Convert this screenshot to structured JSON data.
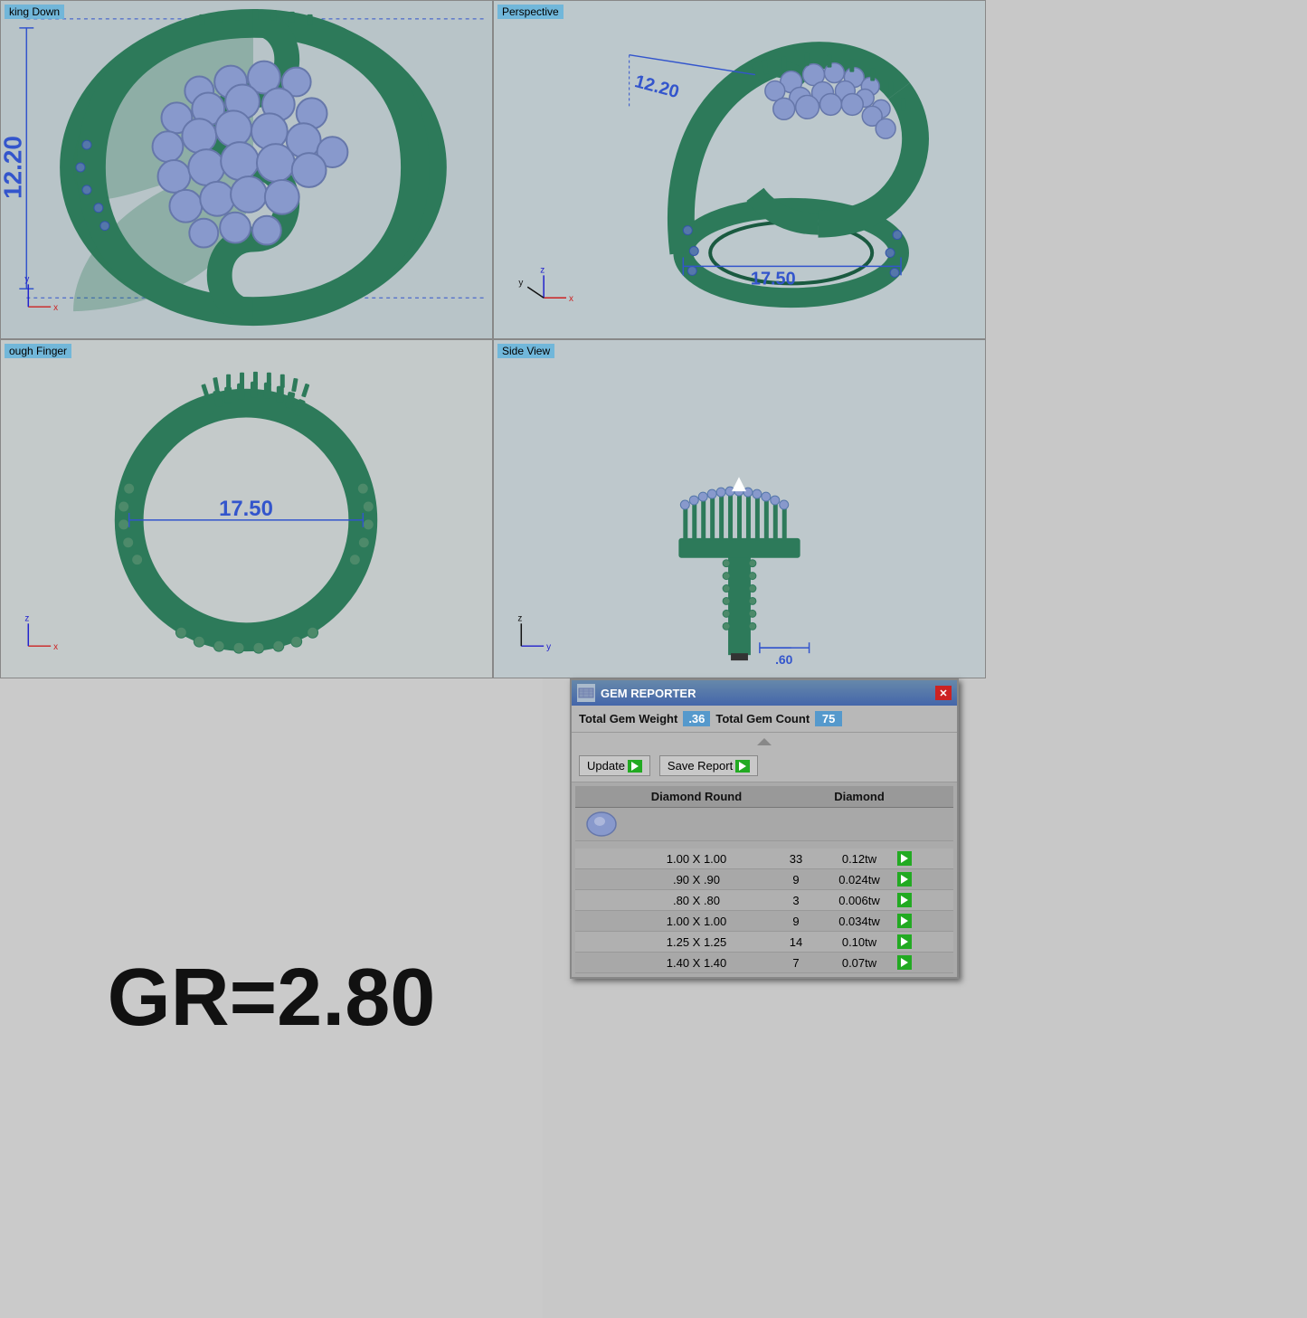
{
  "viewports": {
    "topleft": {
      "label": "king Down",
      "dimension1": "12.20"
    },
    "topright": {
      "label": "Perspective",
      "dimension1": "12.20",
      "dimension2": "17.50"
    },
    "botleft": {
      "label": "ough Finger",
      "dimension1": "17.50"
    },
    "botright": {
      "label": "Side View",
      "dimension1": ".60"
    }
  },
  "gr_value": "GR=2.80",
  "gem_reporter": {
    "title": "GEM REPORTER",
    "total_gem_weight_label": "Total Gem Weight",
    "total_gem_weight_value": ".36",
    "total_gem_count_label": "Total Gem Count",
    "total_gem_count_value": "75",
    "update_label": "Update",
    "save_report_label": "Save Report",
    "table_col1": "",
    "table_col2": "Diamond Round",
    "table_col3": "",
    "table_col4": "Diamond",
    "table_col5": "",
    "rows": [
      {
        "size": "1.00 X 1.00",
        "count": "33",
        "weight": "0.12tw"
      },
      {
        "size": ".90 X .90",
        "count": "9",
        "weight": "0.024tw"
      },
      {
        "size": ".80 X .80",
        "count": "3",
        "weight": "0.006tw"
      },
      {
        "size": "1.00 X 1.00",
        "count": "9",
        "weight": "0.034tw"
      },
      {
        "size": "1.25 X 1.25",
        "count": "14",
        "weight": "0.10tw"
      },
      {
        "size": "1.40 X 1.40",
        "count": "7",
        "weight": "0.07tw"
      }
    ]
  },
  "colors": {
    "ring_green": "#2d7a5a",
    "gem_blue": "#7090b8",
    "dimension_blue": "#3355cc",
    "viewport_bg": "#c4cccc",
    "label_bg": "#5599bb"
  }
}
